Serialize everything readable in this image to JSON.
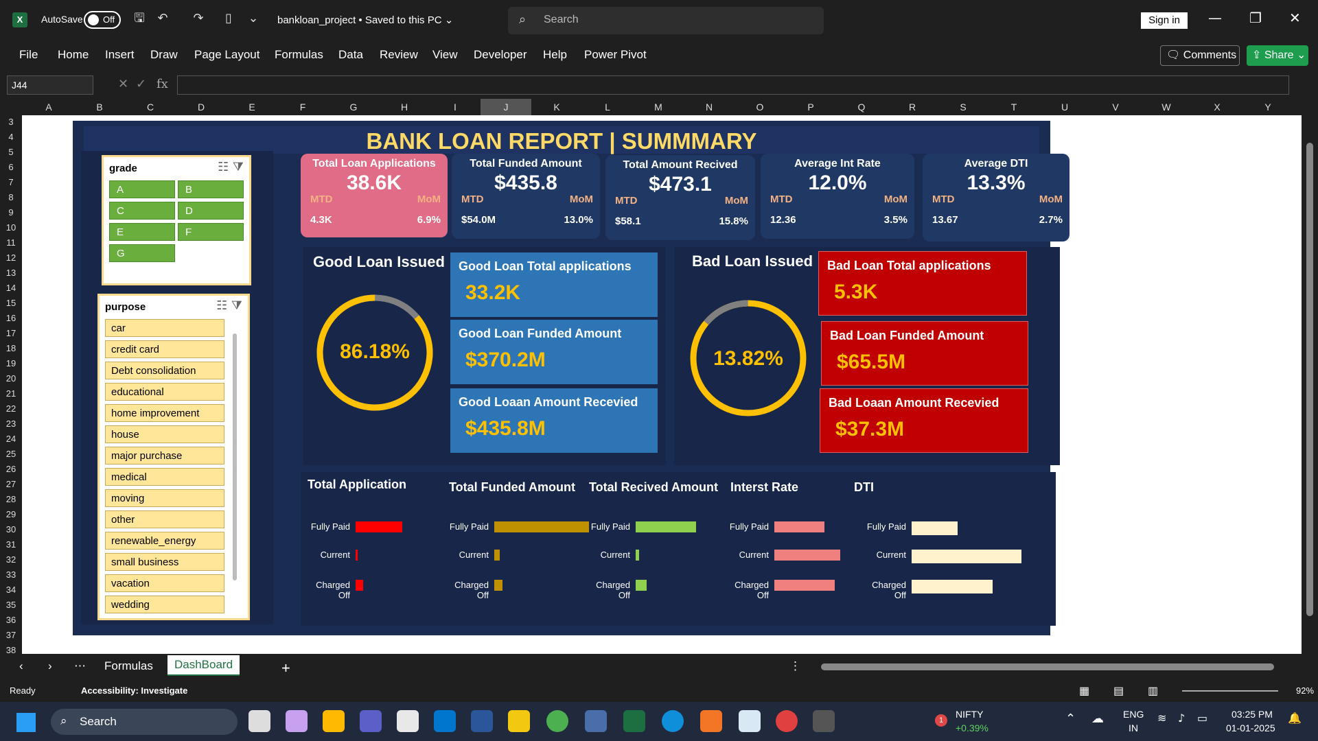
{
  "titlebar": {
    "autosave_label": "AutoSave",
    "autosave_state": "Off",
    "document": "bankloan_project • Saved to this PC ⌄",
    "search_placeholder": "Search",
    "signin": "Sign in"
  },
  "menu": [
    "File",
    "Home",
    "Insert",
    "Draw",
    "Page Layout",
    "Formulas",
    "Data",
    "Review",
    "View",
    "Developer",
    "Help",
    "Power Pivot"
  ],
  "buttons": {
    "comments": "Comments",
    "share": "Share"
  },
  "formula": {
    "namebox": "J44",
    "fx": "fx"
  },
  "columns": [
    "A",
    "B",
    "C",
    "D",
    "E",
    "F",
    "G",
    "H",
    "I",
    "J",
    "K",
    "L",
    "M",
    "N",
    "O",
    "P",
    "Q",
    "R",
    "S",
    "T",
    "U",
    "V",
    "W",
    "X",
    "Y"
  ],
  "selected_column": "J",
  "rows": [
    "3",
    "4",
    "5",
    "6",
    "7",
    "8",
    "9",
    "10",
    "11",
    "12",
    "13",
    "14",
    "15",
    "16",
    "17",
    "18",
    "19",
    "20",
    "21",
    "22",
    "23",
    "24",
    "25",
    "26",
    "27",
    "28",
    "29",
    "30",
    "31",
    "32",
    "33",
    "34",
    "35",
    "36",
    "37",
    "38"
  ],
  "dashboard": {
    "title": "BANK LOAN REPORT | SUMMMARY",
    "grade_slicer": {
      "header": "grade",
      "items": [
        "A",
        "B",
        "C",
        "D",
        "E",
        "F",
        "G"
      ]
    },
    "purpose_slicer": {
      "header": "purpose",
      "items": [
        "car",
        "credit card",
        "Debt consolidation",
        "educational",
        "home improvement",
        "house",
        "major purchase",
        "medical",
        "moving",
        "other",
        "renewable_energy",
        "small business",
        "vacation",
        "wedding"
      ]
    },
    "kpis": [
      {
        "label": "Total Loan Applications",
        "value": "38.6K",
        "mtd_label": "MTD",
        "mom_label": "MoM",
        "mtd": "4.3K",
        "mom": "6.9%"
      },
      {
        "label": "Total Funded Amount",
        "value": "$435.8",
        "mtd_label": "MTD",
        "mom_label": "MoM",
        "mtd": "$54.0M",
        "mom": "13.0%"
      },
      {
        "label": "Total Amount Recived",
        "value": "$473.1",
        "mtd_label": "MTD",
        "mom_label": "MoM",
        "mtd": "$58.1",
        "mom": "15.8%"
      },
      {
        "label": "Average Int Rate",
        "value": "12.0%",
        "mtd_label": "MTD",
        "mom_label": "MoM",
        "mtd": "12.36",
        "mom": "3.5%"
      },
      {
        "label": "Average DTI",
        "value": "13.3%",
        "mtd_label": "MTD",
        "mom_label": "MoM",
        "mtd": "13.67",
        "mom": "2.7%"
      }
    ],
    "good": {
      "title": "Good Loan Issued",
      "pct": "86.18%",
      "pct_value": 0.8618,
      "boxes": [
        {
          "label": "Good Loan Total applications",
          "value": "33.2K"
        },
        {
          "label": "Good Loan Funded Amount",
          "value": "$370.2M"
        },
        {
          "label": "Good Loaan Amount Recevied",
          "value": "$435.8M"
        }
      ]
    },
    "bad": {
      "title": "Bad Loan Issued",
      "pct": "13.82%",
      "pct_value": 0.1382,
      "boxes": [
        {
          "label": "Bad Loan Total applications",
          "value": "5.3K"
        },
        {
          "label": "Bad Loan Funded Amount",
          "value": "$65.5M"
        },
        {
          "label": "Bad Loaan Amount Recevied",
          "value": "$37.3M"
        }
      ]
    },
    "status_charts": [
      {
        "title": "Total Application",
        "color": "#ff0000",
        "labels": [
          "Fully Paid",
          "Current",
          "Charged Off"
        ],
        "values": [
          1.0,
          0.03,
          0.16
        ]
      },
      {
        "title": "Total Funded Amount",
        "color": "#bf9000",
        "labels": [
          "Fully Paid",
          "Current",
          "Charged Off"
        ],
        "values": [
          1.0,
          0.06,
          0.09
        ]
      },
      {
        "title": "Total Recived Amount",
        "color": "#8fd14f",
        "labels": [
          "Fully Paid",
          "Current",
          "Charged Off"
        ],
        "values": [
          1.0,
          0.06,
          0.18
        ]
      },
      {
        "title": "Interst Rate",
        "color": "#f08080",
        "labels": [
          "Fully Paid",
          "Current",
          "Charged Off"
        ],
        "values": [
          0.76,
          1.0,
          0.92
        ]
      },
      {
        "title": "DTI",
        "color": "#fff2cc",
        "labels": [
          "Fully Paid",
          "Current",
          "Charged Off"
        ],
        "values": [
          0.42,
          1.0,
          0.74
        ]
      }
    ]
  },
  "sheet_tabs": [
    "Formulas",
    "DashBoard"
  ],
  "active_tab": "DashBoard",
  "status": {
    "ready": "Ready",
    "accessibility": "Accessibility: Investigate",
    "zoom": "92%"
  },
  "taskbar": {
    "search": "Search",
    "nifty": "NIFTY",
    "nifty_change": "+0.39%",
    "lang1": "ENG",
    "lang2": "IN",
    "time": "03:25 PM",
    "date": "01-01-2025",
    "badge": "1"
  }
}
